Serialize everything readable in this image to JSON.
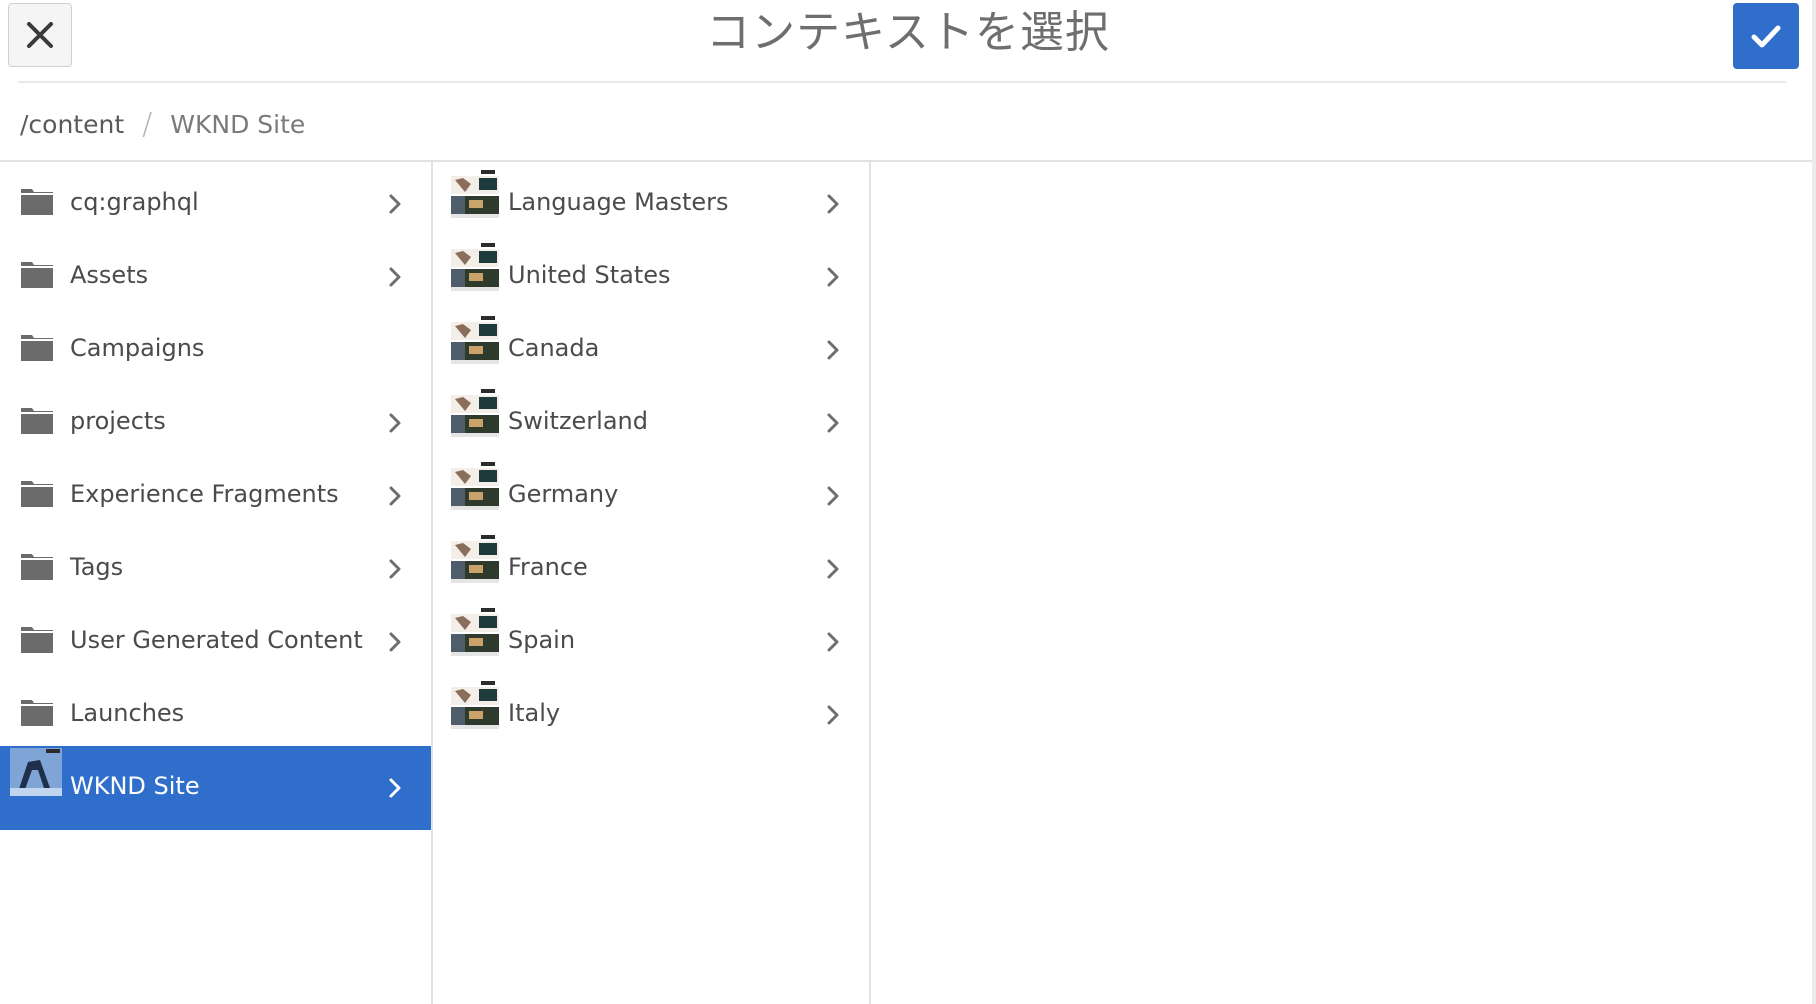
{
  "header": {
    "title": "コンテキストを選択",
    "close_icon": "close-icon",
    "confirm_icon": "checkmark-icon",
    "accent_color": "#2f6fcb"
  },
  "breadcrumb": {
    "items": [
      "/content",
      "WKND Site"
    ],
    "separator": "/"
  },
  "column1": {
    "items": [
      {
        "label": "cq:graphql",
        "icon": "folder-icon",
        "has_children": true
      },
      {
        "label": "Assets",
        "icon": "folder-icon",
        "has_children": true
      },
      {
        "label": "Campaigns",
        "icon": "folder-icon",
        "has_children": false
      },
      {
        "label": "projects",
        "icon": "folder-icon",
        "has_children": true
      },
      {
        "label": "Experience Fragments",
        "icon": "folder-icon",
        "has_children": true
      },
      {
        "label": "Tags",
        "icon": "folder-icon",
        "has_children": true
      },
      {
        "label": "User Generated Content",
        "icon": "folder-icon",
        "has_children": true
      },
      {
        "label": "Launches",
        "icon": "folder-icon",
        "has_children": false
      },
      {
        "label": "WKND Site",
        "icon": "site-thumbnail",
        "has_children": true,
        "selected": true
      }
    ]
  },
  "column2": {
    "items": [
      {
        "label": "Language Masters",
        "icon": "page-thumbnail",
        "has_children": true
      },
      {
        "label": "United States",
        "icon": "page-thumbnail",
        "has_children": true
      },
      {
        "label": "Canada",
        "icon": "page-thumbnail",
        "has_children": true
      },
      {
        "label": "Switzerland",
        "icon": "page-thumbnail",
        "has_children": true
      },
      {
        "label": "Germany",
        "icon": "page-thumbnail",
        "has_children": true
      },
      {
        "label": "France",
        "icon": "page-thumbnail",
        "has_children": true
      },
      {
        "label": "Spain",
        "icon": "page-thumbnail",
        "has_children": true
      },
      {
        "label": "Italy",
        "icon": "page-thumbnail",
        "has_children": true
      }
    ]
  }
}
